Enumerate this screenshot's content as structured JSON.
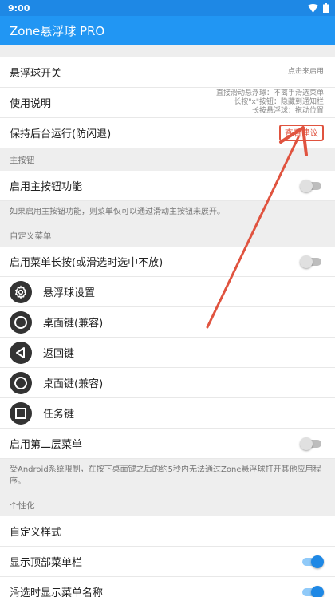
{
  "status_bar": {
    "time": "9:00"
  },
  "app_bar": {
    "title": "Zone悬浮球 PRO"
  },
  "rows": {
    "float_switch": {
      "label": "悬浮球开关",
      "hint": "点击来启用"
    },
    "instructions": {
      "label": "使用说明",
      "hint_lines": [
        "直接滑动悬浮球：不离手滑选菜单",
        "长按\"x\"按钮：隐藏到通知栏",
        "长按悬浮球：拖动位置"
      ]
    },
    "keep_alive": {
      "label": "保持后台运行(防闪退)",
      "button": "查看建议"
    }
  },
  "main_button": {
    "section_title": "主按钮",
    "enable_label": "启用主按钮功能",
    "enabled": false,
    "note": "如果启用主按钮功能，则菜单仅可以通过滑动主按钮来展开。"
  },
  "custom_menu": {
    "section_title": "自定义菜单",
    "long_press_label": "启用菜单长按(或滑选时选中不放)",
    "long_press_enabled": false,
    "items": [
      {
        "label": "悬浮球设置",
        "icon": "gear-icon"
      },
      {
        "label": "桌面键(兼容)",
        "icon": "circle-icon"
      },
      {
        "label": "返回键",
        "icon": "back-triangle-icon"
      },
      {
        "label": "桌面键(兼容)",
        "icon": "circle-icon"
      },
      {
        "label": "任务键",
        "icon": "square-icon"
      }
    ],
    "second_layer_label": "启用第二层菜单",
    "second_layer_enabled": false,
    "note": "受Android系统限制，在按下桌面键之后的约5秒内无法通过Zone悬浮球打开其他应用程序。"
  },
  "personalization": {
    "section_title": "个性化",
    "custom_style_label": "自定义样式",
    "show_top_menu_label": "显示顶部菜单栏",
    "show_top_menu_enabled": true,
    "show_names_label": "滑选时显示菜单名称",
    "show_names_enabled": true
  },
  "colors": {
    "primary": "#2196f3",
    "status_bar": "#1e88e5",
    "annotation": "#e0533f",
    "icon_bg": "#333333"
  }
}
